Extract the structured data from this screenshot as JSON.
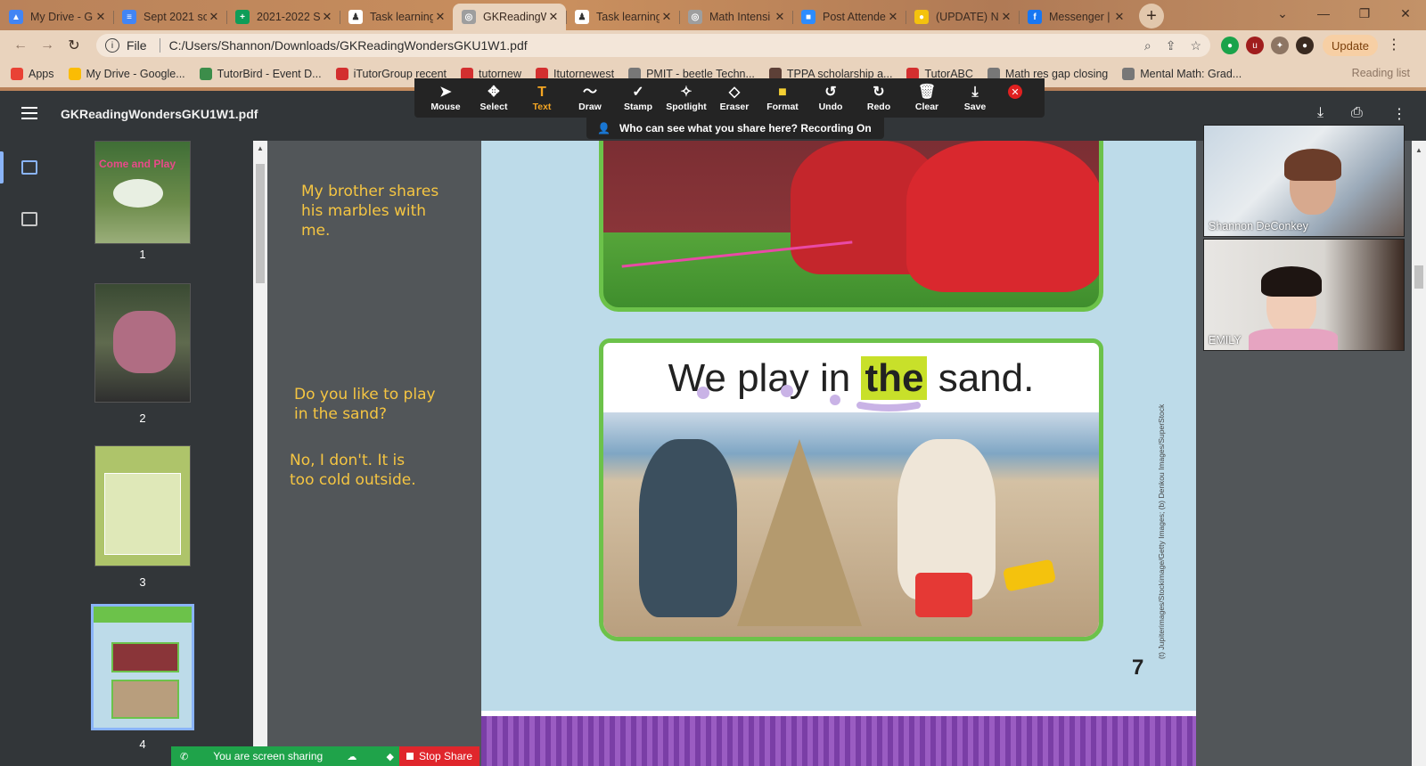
{
  "tabs": [
    {
      "title": "My Drive - G",
      "color": "#4285f4",
      "glyph": "▲"
    },
    {
      "title": "Sept 2021 sc",
      "color": "#4285f4",
      "glyph": "≡"
    },
    {
      "title": "2021-2022 S",
      "color": "#0f9d58",
      "glyph": "+"
    },
    {
      "title": "Task learning",
      "color": "#ffffff",
      "glyph": "♟"
    },
    {
      "title": "GKReadingW",
      "color": "#9e9e9e",
      "glyph": "◎"
    },
    {
      "title": "Task learning",
      "color": "#ffffff",
      "glyph": "♟"
    },
    {
      "title": "Math Intensi",
      "color": "#9e9e9e",
      "glyph": "◎"
    },
    {
      "title": "Post Attende",
      "color": "#2d8cff",
      "glyph": "■"
    },
    {
      "title": "(UPDATE) N",
      "color": "#f4c20d",
      "glyph": "●"
    },
    {
      "title": "Messenger |",
      "color": "#1877f2",
      "glyph": "f"
    }
  ],
  "new_tab": "+",
  "window_controls": {
    "dropdown": "⌄",
    "minimize": "—",
    "restore": "❐",
    "close": "✕"
  },
  "address": {
    "scheme_label": "File",
    "url": "C:/Users/Shannon/Downloads/GKReadingWondersGKU1W1.pdf"
  },
  "update_button": "Update",
  "bookmarks": [
    {
      "label": "Apps",
      "color": "#e94235"
    },
    {
      "label": "My Drive - Google...",
      "color": "#fbbc04"
    },
    {
      "label": "TutorBird - Event D...",
      "color": "#3c8d4a"
    },
    {
      "label": "iTutorGroup recent",
      "color": "#d32f2f"
    },
    {
      "label": "tutornew",
      "color": "#d32f2f"
    },
    {
      "label": "Itutornewest",
      "color": "#d32f2f"
    },
    {
      "label": "PMIT - beetle Techn...",
      "color": "#777777"
    },
    {
      "label": "TPPA scholarship a...",
      "color": "#5d4037"
    },
    {
      "label": "TutorABC",
      "color": "#d32f2f"
    },
    {
      "label": "Math res gap closing",
      "color": "#777777"
    },
    {
      "label": "Mental Math: Grad...",
      "color": "#777777"
    }
  ],
  "reading_list": "Reading list",
  "pdf": {
    "filename": "GKReadingWondersGKU1W1.pdf",
    "page_number": "7"
  },
  "zoom_tools": [
    {
      "label": "Mouse",
      "icon": "➤",
      "active": false
    },
    {
      "label": "Select",
      "icon": "✥",
      "active": false
    },
    {
      "label": "Text",
      "icon": "T",
      "active": true
    },
    {
      "label": "Draw",
      "icon": "〜",
      "active": false
    },
    {
      "label": "Stamp",
      "icon": "✓",
      "active": false
    },
    {
      "label": "Spotlight",
      "icon": "✧",
      "active": false
    },
    {
      "label": "Eraser",
      "icon": "◇",
      "active": false
    },
    {
      "label": "Format",
      "icon": "■",
      "active": false
    },
    {
      "label": "Undo",
      "icon": "↺",
      "active": false
    },
    {
      "label": "Redo",
      "icon": "↻",
      "active": false
    },
    {
      "label": "Clear",
      "icon": "🗑",
      "active": false
    },
    {
      "label": "Save",
      "icon": "⤓",
      "active": false
    }
  ],
  "zoom_notice": "Who can see what you share here? Recording On",
  "thumbnails": [
    {
      "num": "1"
    },
    {
      "num": "2"
    },
    {
      "num": "3"
    },
    {
      "num": "4"
    }
  ],
  "thumb1_text": "Come and Play",
  "notes": {
    "note1": "My brother shares\nhis marbles with\nme.",
    "note2": "Do you like to play\nin the sand?",
    "note3": "No, I don't. It is\ntoo cold outside."
  },
  "sentence": {
    "before": "We play in ",
    "highlight": "the",
    "after": " sand."
  },
  "photo_credit": "(t) Jupiterimages/Stockimage/Getty Images; (b) Denkou Images/SuperStock",
  "participants": [
    {
      "name": "Shannon DeConkey"
    },
    {
      "name": "EMILY"
    }
  ],
  "share_bar": {
    "status": "You are screen sharing",
    "stop": "Stop Share"
  },
  "colors": {
    "zoom_active": "#f5a623",
    "page_bg": "#bddbe9",
    "panel_border": "#6cc24a",
    "note_text": "#f5c542",
    "highlight": "#c8e02a"
  }
}
